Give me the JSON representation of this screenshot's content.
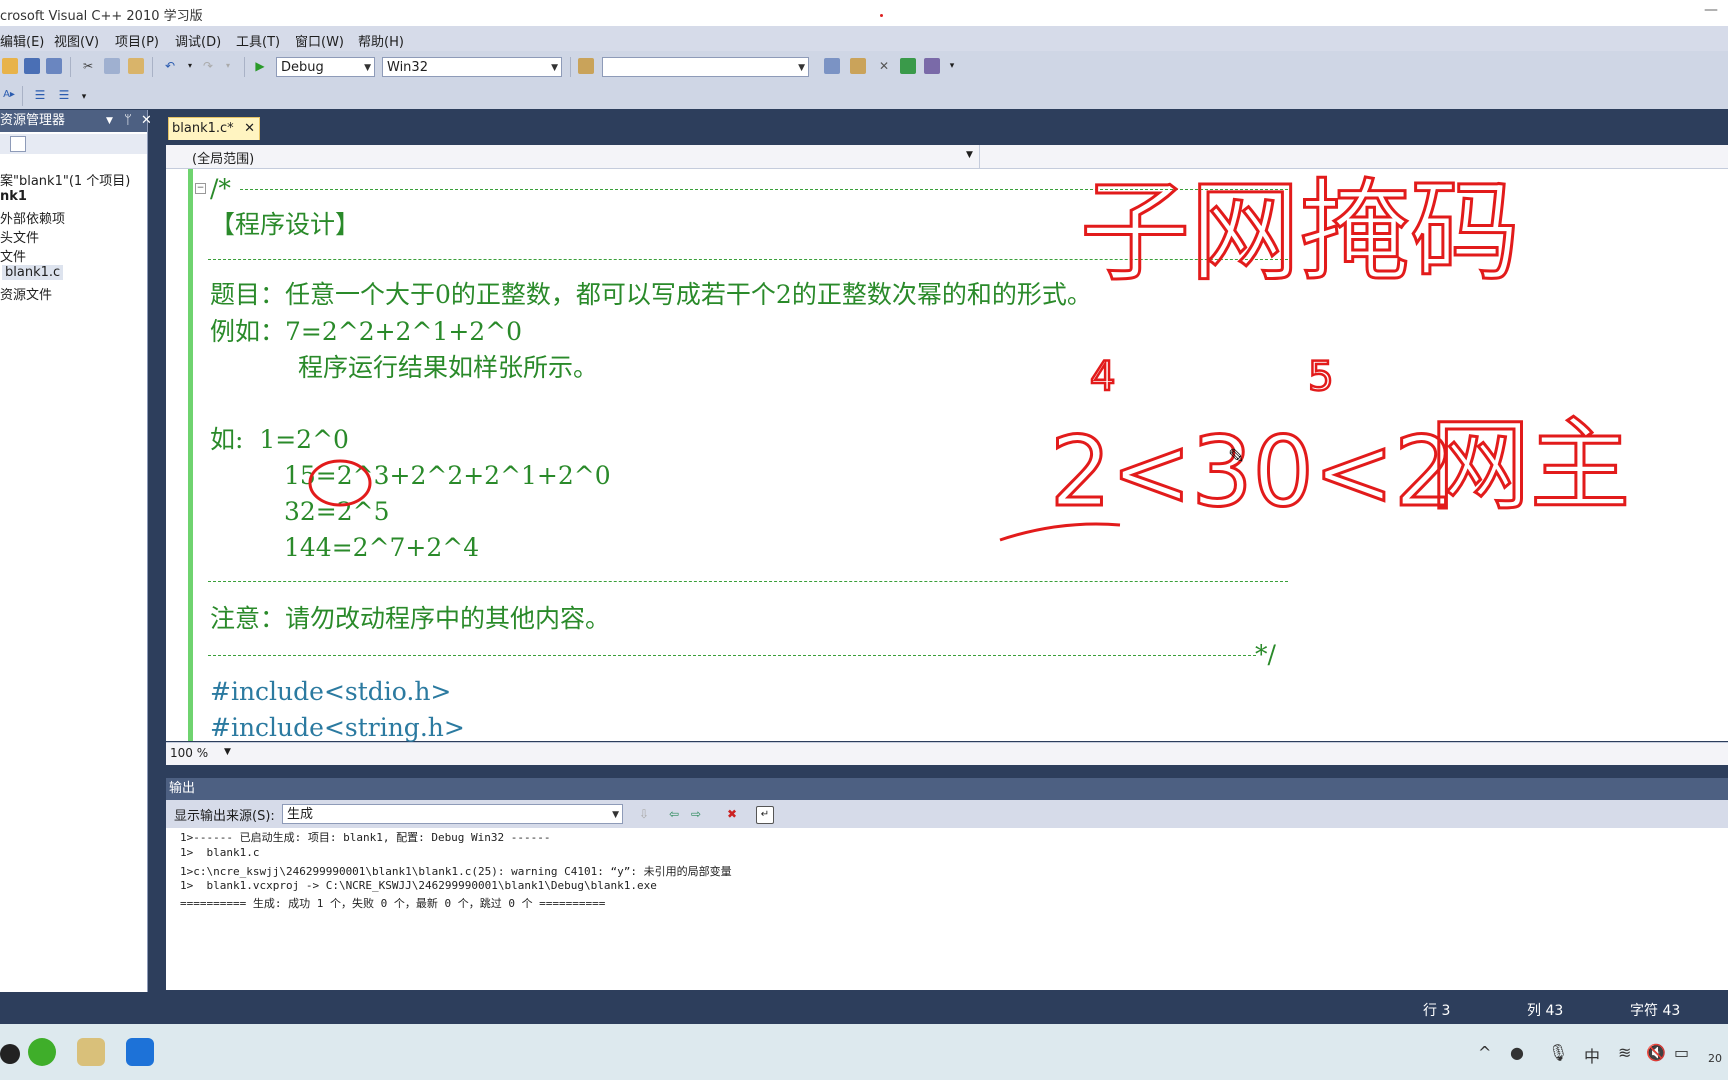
{
  "window": {
    "title": "crosoft Visual C++ 2010 学习版"
  },
  "menu": [
    "编辑(E)",
    "视图(V)",
    "项目(P)",
    "调试(D)",
    "工具(T)",
    "窗口(W)",
    "帮助(H)"
  ],
  "toolbar": {
    "config": "Debug",
    "platform": "Win32",
    "find": ""
  },
  "solution_explorer": {
    "title": "资源管理器",
    "items": [
      "案\"blank1\"(1 个项目)",
      "nk1",
      "外部依赖项",
      "头文件",
      "文件",
      "blank1.c",
      "资源文件"
    ]
  },
  "editor": {
    "tab_label": "blank1.c*",
    "scope": "(全局范围)",
    "zoom": "100 %",
    "lines": {
      "comment_start": "/*",
      "heading": "【程序设计】",
      "problem": "题目：任意一个大于0的正整数，都可以写成若干个2的正整数次幂的和的形式。",
      "example": "例如：7=2^2+2^1+2^0",
      "result_note": "程序运行结果如样张所示。",
      "ex1": "如:  1=2^0",
      "ex2": "15=2^3+2^2+2^1+2^0",
      "ex3": "32=2^5",
      "ex4": "144=2^7+2^4",
      "notice": "注意：请勿改动程序中的其他内容。",
      "comment_end": "*/",
      "include1": "#include<stdio.h>",
      "include2": "#include<string.h>"
    },
    "annotations": {
      "title": "子网掩码",
      "digits": "4 5",
      "expression": "2<30<2",
      "suffix": "网主"
    }
  },
  "output": {
    "title": "输出",
    "source_label": "显示输出来源(S):",
    "source_value": "生成",
    "lines": [
      "1>------ 已启动生成: 项目: blank1, 配置: Debug Win32 ------",
      "1>  blank1.c",
      "1>c:\\ncre_kswjj\\246299990001\\blank1\\blank1.c(25): warning C4101: “y”: 未引用的局部变量",
      "1>  blank1.vcxproj -> C:\\NCRE_KSWJJ\\246299990001\\blank1\\Debug\\blank1.exe",
      "========== 生成: 成功 1 个，失败 0 个，最新 0 个，跳过 0 个 =========="
    ]
  },
  "status": {
    "line": "行 3",
    "col": "列 43",
    "char": "字符 43"
  },
  "taskbar": {
    "ime": "中",
    "clock": "20"
  }
}
